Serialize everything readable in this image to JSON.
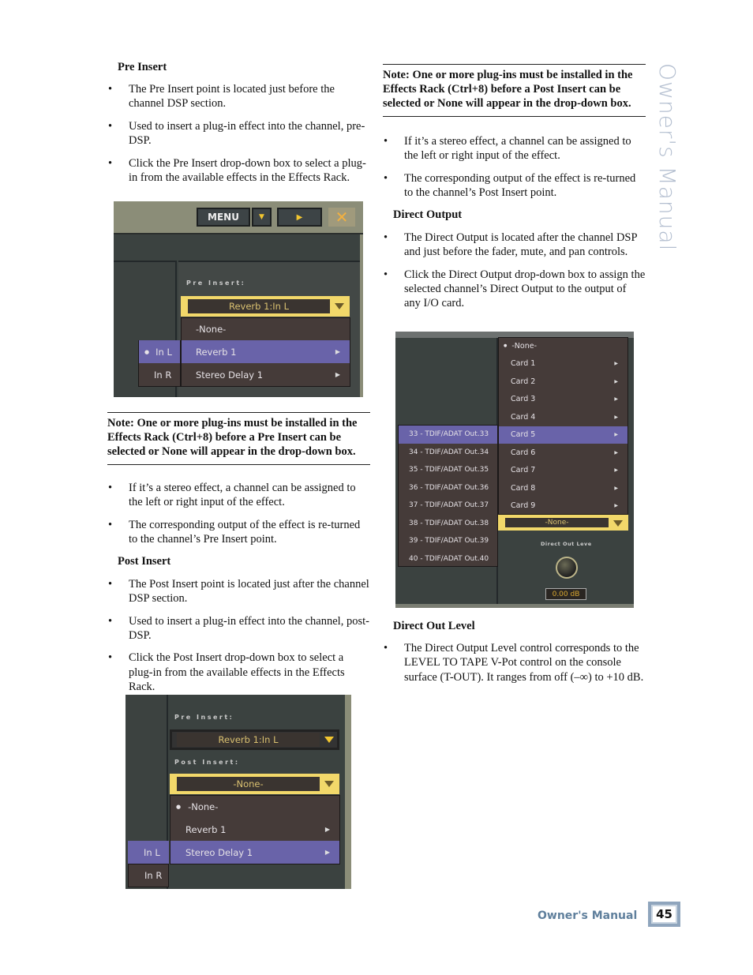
{
  "side_title": "Owner's Manual",
  "footer": {
    "label": "Owner's Manual",
    "page_number": "45"
  },
  "left": {
    "pre_insert": {
      "heading": "Pre Insert",
      "bullets": [
        "The Pre Insert point is located just before the channel DSP section.",
        "Used to insert a plug-in effect into the channel, pre-DSP.",
        "Click the Pre Insert drop-down box to select a plug-in from the available effects in the Effects Rack."
      ]
    },
    "note": "Note: One or more plug-ins must be installed in the Effects Rack (Ctrl+8) before a Pre Insert can be selected or None will appear in the drop-down box.",
    "bullets2": [
      "If it’s a stereo effect, a channel can be assigned to the left or right input of the effect.",
      "The corresponding output of the effect is re-turned to the channel’s Pre Insert point."
    ],
    "post_insert": {
      "heading": "Post Insert",
      "bullets": [
        "The Post Insert point is located just after the channel DSP section.",
        "Used to insert a plug-in effect into the channel, post-DSP.",
        "Click the Post Insert drop-down box to select a plug-in from the available effects in the Effects Rack."
      ]
    }
  },
  "right": {
    "note": "Note: One or more plug-ins must be installed in the Effects Rack (Ctrl+8) before a Post Insert can be selected or None will appear in the drop-down box.",
    "bullets1": [
      "If it’s a stereo effect, a channel can be assigned to the left or right input of the effect.",
      "The corresponding output of the effect is re-turned to the channel’s Post Insert point."
    ],
    "direct_output": {
      "heading": "Direct Output",
      "bullets": [
        "The Direct Output is located after the channel DSP and just before the fader, mute, and pan controls.",
        "Click the Direct Output drop-down box to assign the selected channel’s Direct Output to the output of any I/O card."
      ]
    },
    "direct_out_level": {
      "heading": "Direct Out Level",
      "bullets": [
        "The Direct Output Level control corresponds to the LEVEL TO TAPE V-Pot control on the console surface (T-OUT). It ranges from off (–∞) to +10 dB."
      ]
    }
  },
  "shot1": {
    "menu_label": "MENU",
    "pre_insert_label": "Pre Insert:",
    "dropdown_value": "Reverb 1:In L",
    "menu_items": [
      "-None-",
      "Reverb 1",
      "Stereo Delay 1"
    ],
    "submenu": [
      "In L",
      "In R"
    ]
  },
  "shot2": {
    "menu_items": [
      "-None-",
      "Card 1",
      "Card 2",
      "Card 3",
      "Card 4",
      "Card 5",
      "Card 6",
      "Card 7",
      "Card 8",
      "Card 9"
    ],
    "submenu": [
      "33 - TDIF/ADAT Out.33",
      "34 - TDIF/ADAT Out.34",
      "35 - TDIF/ADAT Out.35",
      "36 - TDIF/ADAT Out.36",
      "37 - TDIF/ADAT Out.37",
      "38 - TDIF/ADAT Out.38",
      "39 - TDIF/ADAT Out.39",
      "40 - TDIF/ADAT Out.40"
    ],
    "dropdown_value": "-None-",
    "level_label": "Direct Out Leve",
    "knob_value": "0.00 dB"
  },
  "shot3": {
    "pre_insert_label": "Pre Insert:",
    "pre_value": "Reverb 1:In L",
    "post_insert_label": "Post Insert:",
    "post_value": "-None-",
    "menu_items": [
      "-None-",
      "Reverb 1",
      "Stereo Delay 1"
    ],
    "submenu": [
      "In L",
      "In R"
    ]
  },
  "colors": {
    "highlight": "#6963a9",
    "menu_bg": "#453b39",
    "dropdown_border": "#f2d86a",
    "accent_blue": "#5f7f9c"
  }
}
